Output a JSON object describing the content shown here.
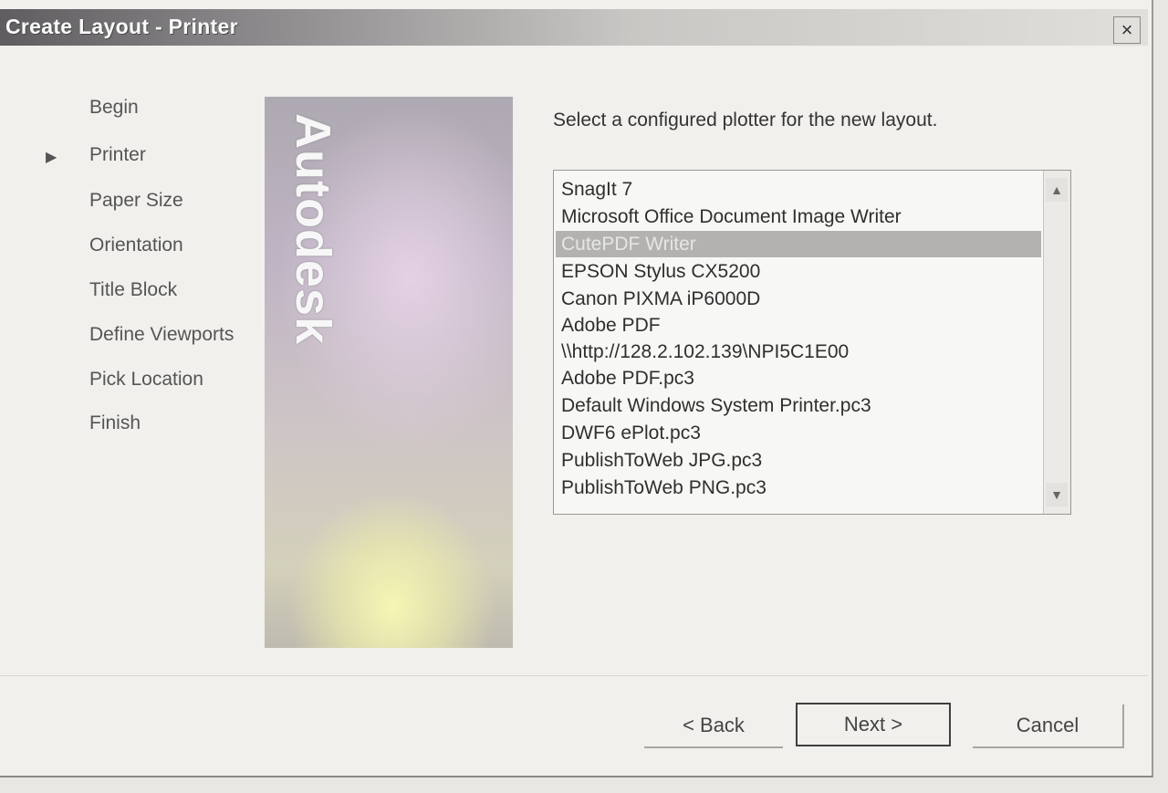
{
  "window": {
    "title": "Create Layout - Printer",
    "close_glyph": "×"
  },
  "steps": [
    {
      "label": "Begin",
      "current": false
    },
    {
      "label": "Printer",
      "current": true
    },
    {
      "label": "Paper Size",
      "current": false
    },
    {
      "label": "Orientation",
      "current": false
    },
    {
      "label": "Title Block",
      "current": false
    },
    {
      "label": "Define Viewports",
      "current": false
    },
    {
      "label": "Pick Location",
      "current": false
    },
    {
      "label": "Finish",
      "current": false
    }
  ],
  "current_step_arrow": "▶",
  "banner": {
    "text": "Autodesk"
  },
  "main": {
    "prompt": "Select a configured plotter for the new layout.",
    "printers": [
      "SnagIt 7",
      "Microsoft Office Document Image Writer",
      "CutePDF Writer",
      "EPSON Stylus CX5200",
      "Canon PIXMA iP6000D",
      "Adobe PDF",
      "\\\\http://128.2.102.139\\NPI5C1E00",
      "Adobe PDF.pc3",
      "Default Windows System Printer.pc3",
      "DWF6 ePlot.pc3",
      "PublishToWeb JPG.pc3",
      "PublishToWeb PNG.pc3"
    ],
    "selected_index": 2,
    "scroll_up_glyph": "▲",
    "scroll_down_glyph": "▼"
  },
  "buttons": {
    "back": "< Back",
    "next": "Next >",
    "cancel": "Cancel"
  }
}
